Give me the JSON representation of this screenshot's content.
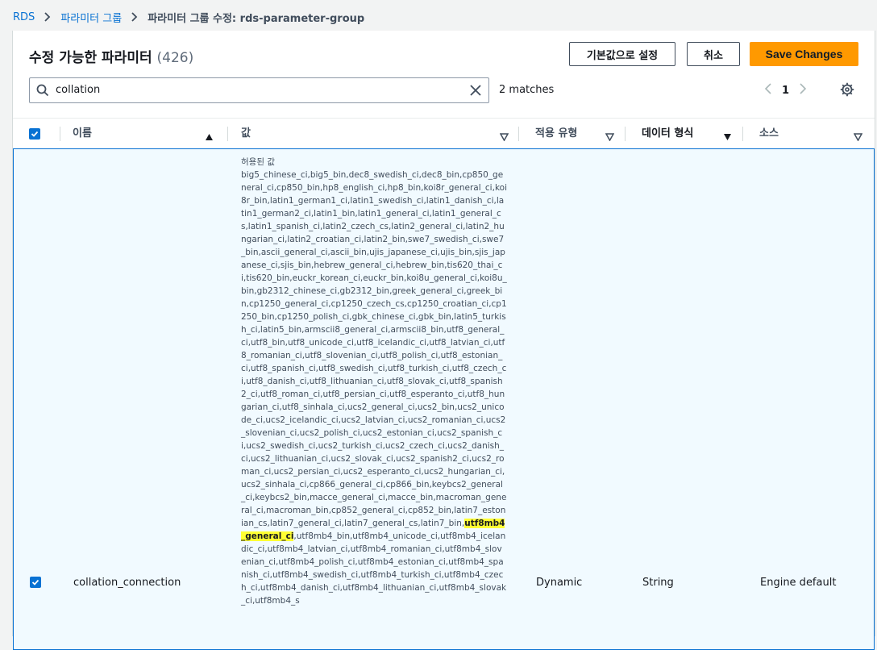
{
  "breadcrumbs": [
    "RDS",
    "파라미터 그룹",
    "파라미터 그룹 수정: rds-parameter-group"
  ],
  "header": {
    "title": "수정 가능한 파라미터",
    "count": "(426)",
    "reset_label": "기본값으로 설정",
    "cancel_label": "취소",
    "save_label": "Save Changes"
  },
  "search": {
    "value": "collation",
    "matches": "2 matches"
  },
  "pagination": {
    "current_page": "1"
  },
  "columns": {
    "name": "이름",
    "value": "값",
    "apply_type": "적용 유형",
    "data_type": "데이터 형식",
    "source": "소스"
  },
  "row": {
    "name": "collation_connection",
    "apply_type": "Dynamic",
    "data_type": "String",
    "source": "Engine default",
    "allowed_label": "허용된 값",
    "allowed_before": "big5_chinese_ci,big5_bin,dec8_swedish_ci,dec8_bin,cp850_general_ci,cp850_bin,hp8_english_ci,hp8_bin,koi8r_general_ci,koi8r_bin,latin1_german1_ci,latin1_swedish_ci,latin1_danish_ci,latin1_german2_ci,latin1_bin,latin1_general_ci,latin1_general_cs,latin1_spanish_ci,latin2_czech_cs,latin2_general_ci,latin2_hungarian_ci,latin2_croatian_ci,latin2_bin,swe7_swedish_ci,swe7_bin,ascii_general_ci,ascii_bin,ujis_japanese_ci,ujis_bin,sjis_japanese_ci,sjis_bin,hebrew_general_ci,hebrew_bin,tis620_thai_ci,tis620_bin,euckr_korean_ci,euckr_bin,koi8u_general_ci,koi8u_bin,gb2312_chinese_ci,gb2312_bin,greek_general_ci,greek_bin,cp1250_general_ci,cp1250_czech_cs,cp1250_croatian_ci,cp1250_bin,cp1250_polish_ci,gbk_chinese_ci,gbk_bin,latin5_turkish_ci,latin5_bin,armscii8_general_ci,armscii8_bin,utf8_general_ci,utf8_bin,utf8_unicode_ci,utf8_icelandic_ci,utf8_latvian_ci,utf8_romanian_ci,utf8_slovenian_ci,utf8_polish_ci,utf8_estonian_ci,utf8_spanish_ci,utf8_swedish_ci,utf8_turkish_ci,utf8_czech_ci,utf8_danish_ci,utf8_lithuanian_ci,utf8_slovak_ci,utf8_spanish2_ci,utf8_roman_ci,utf8_persian_ci,utf8_esperanto_ci,utf8_hungarian_ci,utf8_sinhala_ci,ucs2_general_ci,ucs2_bin,ucs2_unicode_ci,ucs2_icelandic_ci,ucs2_latvian_ci,ucs2_romanian_ci,ucs2_slovenian_ci,ucs2_polish_ci,ucs2_estonian_ci,ucs2_spanish_ci,ucs2_swedish_ci,ucs2_turkish_ci,ucs2_czech_ci,ucs2_danish_ci,ucs2_lithuanian_ci,ucs2_slovak_ci,ucs2_spanish2_ci,ucs2_roman_ci,ucs2_persian_ci,ucs2_esperanto_ci,ucs2_hungarian_ci,ucs2_sinhala_ci,cp866_general_ci,cp866_bin,keybcs2_general_ci,keybcs2_bin,macce_general_ci,macce_bin,macroman_general_ci,macroman_bin,cp852_general_ci,cp852_bin,latin7_estonian_cs,latin7_general_ci,latin7_general_cs,latin7_bin,",
    "allowed_highlight": "utf8mb4_general_ci",
    "allowed_after": ",utf8mb4_bin,utf8mb4_unicode_ci,utf8mb4_icelandic_ci,utf8mb4_latvian_ci,utf8mb4_romanian_ci,utf8mb4_slovenian_ci,utf8mb4_polish_ci,utf8mb4_estonian_ci,utf8mb4_spanish_ci,utf8mb4_swedish_ci,utf8mb4_turkish_ci,utf8mb4_czech_ci,utf8mb4_danish_ci,utf8mb4_lithuanian_ci,utf8mb4_slovak_ci,utf8mb4_s"
  }
}
